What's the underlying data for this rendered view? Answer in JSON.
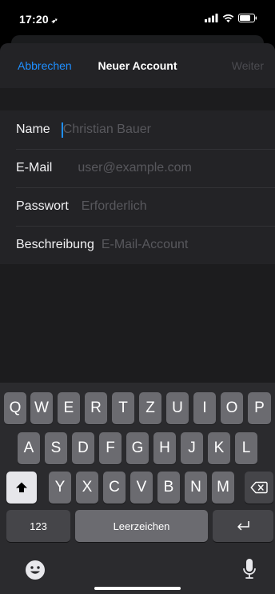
{
  "status_bar": {
    "time": "17:20"
  },
  "nav": {
    "cancel": "Abbrechen",
    "title": "Neuer Account",
    "next": "Weiter"
  },
  "form": {
    "rows": [
      {
        "label": "Name",
        "placeholder": "Christian Bauer",
        "value": ""
      },
      {
        "label": "E-Mail",
        "placeholder": "user@example.com",
        "value": ""
      },
      {
        "label": "Passwort",
        "placeholder": "Erforderlich",
        "value": ""
      },
      {
        "label": "Beschreibung",
        "placeholder": "E-Mail-Account",
        "value": ""
      }
    ]
  },
  "keyboard": {
    "row1": [
      "Q",
      "W",
      "E",
      "R",
      "T",
      "Z",
      "U",
      "I",
      "O",
      "P"
    ],
    "row2": [
      "A",
      "S",
      "D",
      "F",
      "G",
      "H",
      "J",
      "K",
      "L"
    ],
    "row3": [
      "Y",
      "X",
      "C",
      "V",
      "B",
      "N",
      "M"
    ],
    "numbers_key": "123",
    "space_key": "Leerzeichen"
  },
  "colors": {
    "accent": "#1f8fff",
    "background": "#000000",
    "sheet": "#1c1c1e",
    "disabled": "#4b4b50"
  },
  "icons": {
    "location": "location-arrow-icon",
    "signal": "signal-icon",
    "wifi": "wifi-icon",
    "battery": "battery-icon",
    "shift": "shift-icon",
    "delete": "delete-icon",
    "return": "return-icon",
    "emoji": "emoji-icon",
    "mic": "microphone-icon"
  }
}
